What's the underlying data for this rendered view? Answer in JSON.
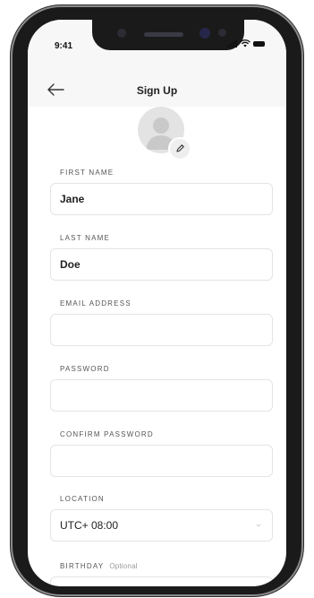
{
  "status_bar": {
    "time": "9:41"
  },
  "nav": {
    "title": "Sign Up",
    "back_icon": "arrow-left-icon"
  },
  "avatar": {
    "icon": "user-placeholder-icon",
    "edit_icon": "pencil-icon"
  },
  "form": {
    "first_name": {
      "label": "FIRST NAME",
      "value": "Jane"
    },
    "last_name": {
      "label": "LAST NAME",
      "value": "Doe"
    },
    "email": {
      "label": "EMAIL ADDRESS",
      "value": ""
    },
    "password": {
      "label": "PASSWORD",
      "value": ""
    },
    "confirm_password": {
      "label": "CONFIRM PASSWORD",
      "value": ""
    },
    "location": {
      "label": "LOCATION",
      "value": "UTC+ 08:00"
    },
    "birthday": {
      "label": "BIRTHDAY",
      "hint": "Optional"
    }
  },
  "colors": {
    "frame": "#1a1a1a",
    "header_bg": "#f7f7f7",
    "field_border": "#e4e4e4",
    "avatar_bg": "#e3e3e3"
  }
}
